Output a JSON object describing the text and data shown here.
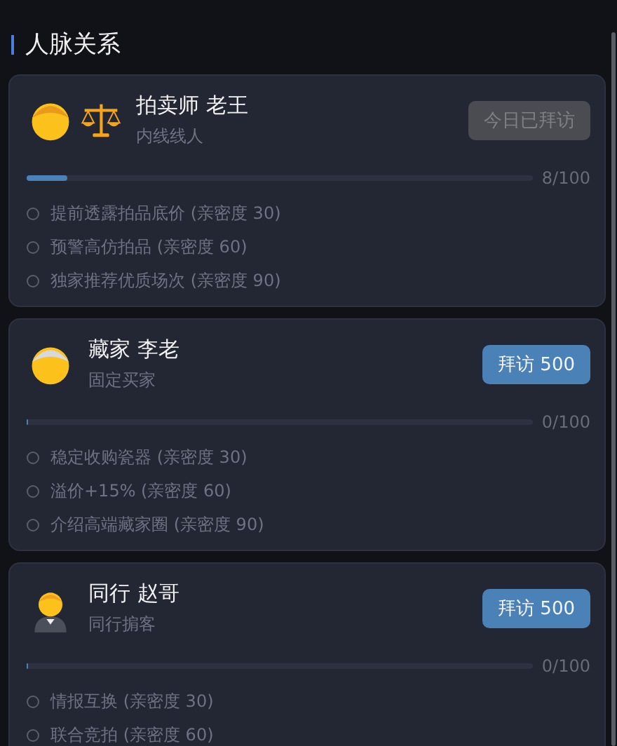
{
  "section": {
    "title": "人脉关系"
  },
  "contacts": [
    {
      "icons": [
        {
          "kind": "young"
        },
        {
          "kind": "scale"
        }
      ],
      "name": "拍卖师 老王",
      "role": "内线线人",
      "button": {
        "label": "今日已拜访",
        "disabled": true
      },
      "level": 0.08,
      "progress": "8/100",
      "perks": [
        {
          "label": "提前透露拍品底价 (亲密度 30)",
          "unlocked": false
        },
        {
          "label": "预警高仿拍品 (亲密度 60)",
          "unlocked": false
        },
        {
          "label": "独家推荐优质场次 (亲密度 90)",
          "unlocked": false
        }
      ]
    },
    {
      "icons": [
        {
          "kind": "elder"
        }
      ],
      "name": "藏家 李老",
      "role": "固定买家",
      "button": {
        "label": "拜访 500",
        "disabled": false
      },
      "level": 0,
      "progress": "0/100",
      "perks": [
        {
          "label": "稳定收购瓷器 (亲密度 30)",
          "unlocked": false
        },
        {
          "label": "溢价+15% (亲密度 60)",
          "unlocked": false
        },
        {
          "label": "介绍高端藏家圈 (亲密度 90)",
          "unlocked": false
        }
      ]
    },
    {
      "icons": [
        {
          "kind": "suited"
        }
      ],
      "name": "同行 赵哥",
      "role": "同行掮客",
      "button": {
        "label": "拜访 500",
        "disabled": false
      },
      "level": 0,
      "progress": "0/100",
      "perks": [
        {
          "label": "情报互换 (亲密度 30)",
          "unlocked": false
        },
        {
          "label": "联合竞拍 (亲密度 60)",
          "unlocked": false
        }
      ]
    }
  ]
}
